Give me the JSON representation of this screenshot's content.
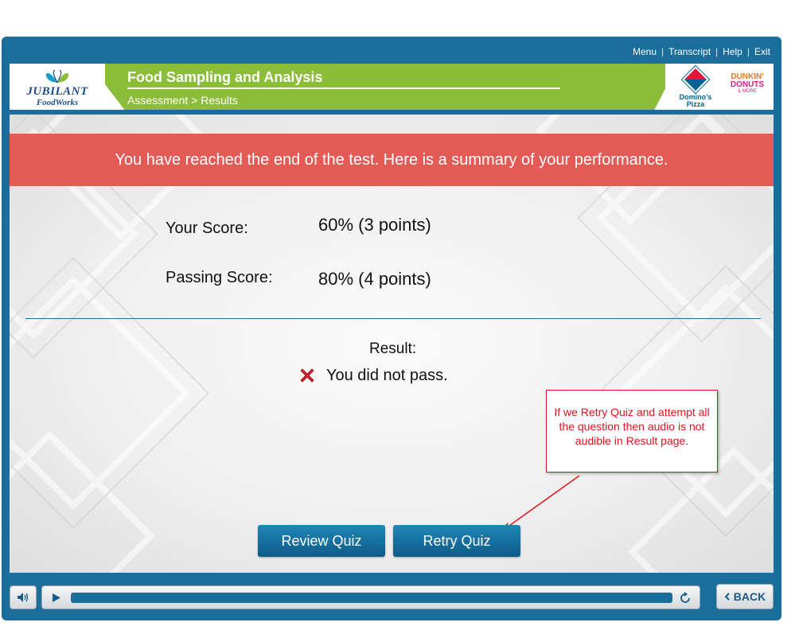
{
  "top_nav": {
    "menu": "Menu",
    "transcript": "Transcript",
    "help": "Help",
    "exit": "Exit",
    "separator": "|"
  },
  "header": {
    "logo_left_line1": "JUBILANT",
    "logo_left_line2": "FoodWorks",
    "course_title": "Food Sampling and Analysis",
    "breadcrumb": "Assessment > Results",
    "brand_dominos_line1": "Domino's",
    "brand_dominos_line2": "Pizza",
    "brand_dunkin_line1": "DUNKIN'",
    "brand_dunkin_line2": "DONUTS",
    "brand_dunkin_line3": "& MORE"
  },
  "results": {
    "banner": "You have reached the end of the test. Here is a summary of your performance.",
    "your_score_label": "Your Score:",
    "your_score_value": "60% (3 points)",
    "passing_score_label": "Passing Score:",
    "passing_score_value": "80% (4 points)",
    "result_label": "Result:",
    "result_value": "You did not pass."
  },
  "annotation": {
    "text": "If we Retry Quiz and attempt all the question then audio is not audible in Result page."
  },
  "buttons": {
    "review_quiz": "Review Quiz",
    "retry_quiz": "Retry Quiz"
  },
  "controls": {
    "back": "BACK",
    "progress": 1.0
  },
  "colors": {
    "frame": "#1a6e9c",
    "header_green": "#8cbd3a",
    "banner_red": "#e45a55",
    "button_blue": "#0e5b88",
    "annotation_red": "#e0141e"
  },
  "icons": {
    "audio": "speaker-icon",
    "play": "play-icon",
    "replay": "replay-icon",
    "back": "chevron-left-icon",
    "fail": "x-mark-icon"
  }
}
